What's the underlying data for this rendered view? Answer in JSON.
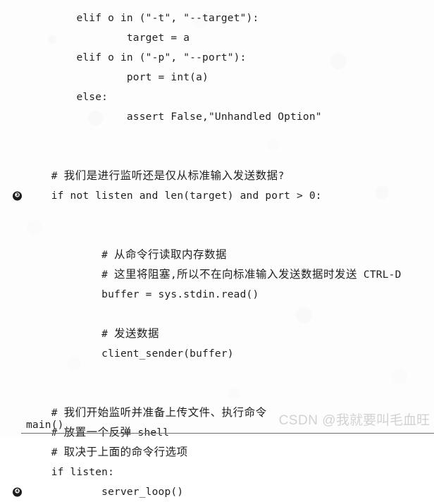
{
  "page": {
    "background_color": "#fdfdfd",
    "text_color": "#1f1f1f",
    "rule_color": "#6f6f6f"
  },
  "code_listing": {
    "lines": [
      {
        "callout": "",
        "text": "        elif o in (\"-t\", \"--target\"):"
      },
      {
        "callout": "",
        "text": "                target = a"
      },
      {
        "callout": "",
        "text": "        elif o in (\"-p\", \"--port\"):"
      },
      {
        "callout": "",
        "text": "                port = int(a)"
      },
      {
        "callout": "",
        "text": "        else:"
      },
      {
        "callout": "",
        "text": "                assert False,\"Unhandled Option\""
      },
      {
        "callout": "",
        "text": ""
      },
      {
        "callout": "",
        "text": ""
      },
      {
        "callout": "",
        "text": "    # 我们是进行监听还是仅从标准输入发送数据?"
      },
      {
        "callout": "❸",
        "text": "    if not listen and len(target) and port > 0:"
      },
      {
        "callout": "",
        "text": ""
      },
      {
        "callout": "",
        "text": ""
      },
      {
        "callout": "",
        "text": "            # 从命令行读取内存数据"
      },
      {
        "callout": "",
        "text": "            # 这里将阻塞,所以不在向标准输入发送数据时发送 CTRL-D"
      },
      {
        "callout": "",
        "text": "            buffer = sys.stdin.read()"
      },
      {
        "callout": "",
        "text": ""
      },
      {
        "callout": "",
        "text": "            # 发送数据"
      },
      {
        "callout": "",
        "text": "            client_sender(buffer)"
      },
      {
        "callout": "",
        "text": ""
      },
      {
        "callout": "",
        "text": ""
      },
      {
        "callout": "",
        "text": "    # 我们开始监听并准备上传文件、执行命令"
      },
      {
        "callout": "",
        "text": "    # 放置一个反弹 shell"
      },
      {
        "callout": "",
        "text": "    # 取决于上面的命令行选项"
      },
      {
        "callout": "",
        "text": "    if listen:"
      },
      {
        "callout": "❹",
        "text": "            server_loop()"
      }
    ]
  },
  "footer": {
    "code": "main()"
  },
  "watermark": {
    "prefix": "CSDN @",
    "handle": "我就要叫毛血旺",
    "color": "#d2d2d2"
  }
}
